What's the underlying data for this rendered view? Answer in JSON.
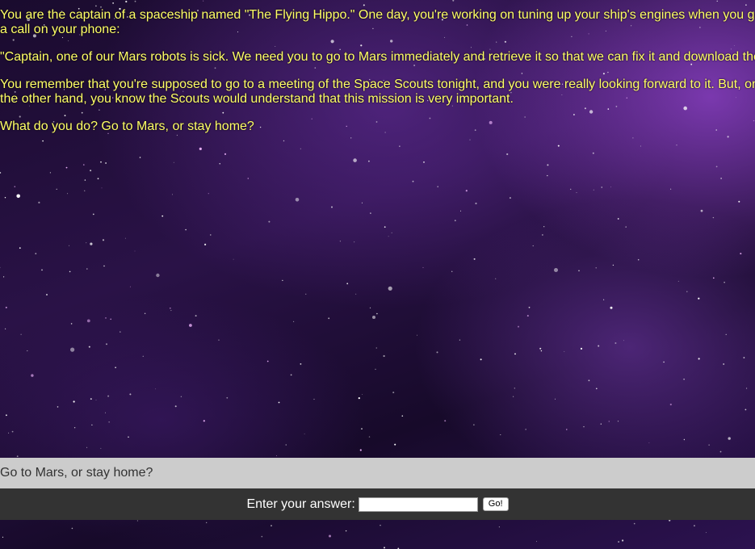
{
  "story": {
    "p1": "You are the captain of a spaceship named \"The Flying Hippo.\" One day, you're working on tuning up your ship's engines when you get a call on your phone:",
    "p2": "\"Captain, one of our Mars robots is sick. We need you to go to Mars immediately and retrieve it so that we can fix it and download the",
    "p3": "You remember that you're supposed to go to a meeting of the Space Scouts tonight, and you were really looking forward to it. But, on the other hand, you know the Scouts would understand that this mission is very important.",
    "p4": "What do you do? Go to Mars, or stay home?"
  },
  "question": {
    "text": "Go to Mars, or stay home?"
  },
  "answer": {
    "label": "Enter your answer:",
    "value": "",
    "button_label": "Go!"
  },
  "colors": {
    "story_text": "#ffff66",
    "question_bar": "#cccccc",
    "answer_bar": "#333333"
  }
}
